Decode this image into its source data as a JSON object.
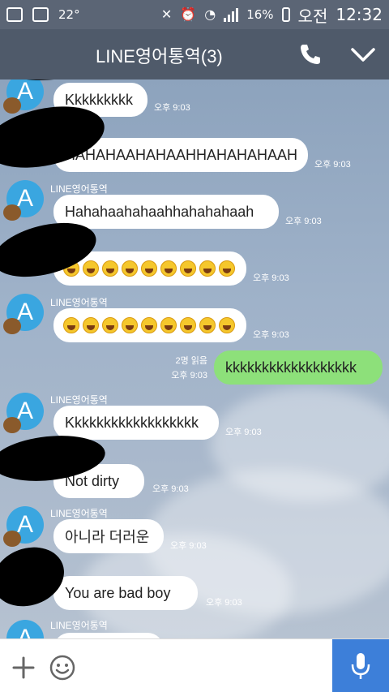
{
  "status_bar": {
    "temperature": "22°",
    "battery": "16%",
    "ampm": "오전",
    "time": "12:32"
  },
  "header": {
    "title": "LINE영어통역(3)"
  },
  "messages": [
    {
      "type": "in",
      "sender": "",
      "text": "Kkkkkkkkk",
      "time": "오후 9:03"
    },
    {
      "type": "in",
      "sender": "",
      "text": "HAHAHAAHAHAAHHAHAHAHAAH",
      "time": "오후 9:03"
    },
    {
      "type": "in",
      "sender": "LINE영어통역",
      "text": "Hahahaahahaahhahahahaah",
      "time": "오후 9:03"
    },
    {
      "type": "in",
      "sender": "",
      "emoji_count": 9,
      "time": "오후 9:03"
    },
    {
      "type": "in",
      "sender": "LINE영어통역",
      "emoji_count": 9,
      "time": "오후 9:03"
    },
    {
      "type": "out",
      "read": "2명 읽음",
      "text": "kkkkkkkkkkkkkkkkkk",
      "time": "오후 9:03"
    },
    {
      "type": "in",
      "sender": "LINE영어통역",
      "text": "Kkkkkkkkkkkkkkkkkk",
      "time": "오후 9:03"
    },
    {
      "type": "in",
      "sender": "",
      "text": "Not dirty",
      "time": "오후 9:03"
    },
    {
      "type": "in",
      "sender": "LINE영어통역",
      "text": "아니라 더러운",
      "time": "오후 9:03"
    },
    {
      "type": "in",
      "sender": "",
      "text": "You are bad boy",
      "time": "오후 9:03"
    },
    {
      "type": "in",
      "sender": "LINE영어통역",
      "text": "",
      "time": ""
    }
  ],
  "avatar_letter": "A",
  "colors": {
    "header": "#4f5a6a",
    "incoming_bubble": "#ffffff",
    "outgoing_bubble": "#8de07a",
    "mic_button": "#3d7fd9",
    "avatar": "#3aa6e0"
  },
  "input_bar": {
    "icons": [
      "plus-icon",
      "emoji-icon",
      "microphone-icon"
    ]
  }
}
